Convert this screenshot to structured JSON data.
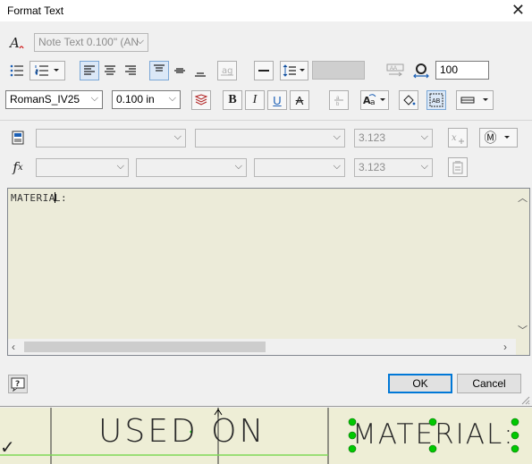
{
  "dialog": {
    "title": "Format Text",
    "close_glyph": "✕"
  },
  "row1": {
    "style_combo": "Note Text 0.100\" (AN"
  },
  "row2": {
    "stretch_value": "100"
  },
  "row3": {
    "font_combo": "RomanS_IV25",
    "size_combo": "0.100 in",
    "bold": "B",
    "italic": "I",
    "underline": "U",
    "strike": "A"
  },
  "row4": {
    "param_value": "3.123",
    "ref_glyph": "Ⓜ"
  },
  "row5": {
    "fx": "f",
    "fx_sub": "x",
    "param_value": "3.123"
  },
  "editor": {
    "text_before_caret": "MATERIA",
    "text_after_caret": "L:"
  },
  "buttons": {
    "ok": "OK",
    "cancel": "Cancel",
    "help": "?"
  },
  "drawing": {
    "used_on": "USED ON",
    "material": "MATERIAL:",
    "check": "✓",
    "accent_green": "#00c800"
  }
}
